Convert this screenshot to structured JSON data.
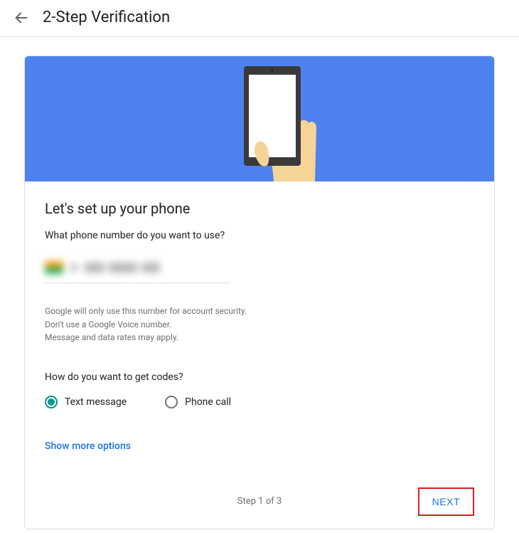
{
  "header": {
    "title": "2-Step Verification"
  },
  "main": {
    "heading": "Let's set up your phone",
    "subheading": "What phone number do you want to use?",
    "info_line_1": "Google will only use this number for account security.",
    "info_line_2": "Don't use a Google Voice number.",
    "info_line_3": "Message and data rates may apply.",
    "codes_heading": "How do you want to get codes?",
    "radio_text": "Text message",
    "radio_call": "Phone call",
    "show_more": "Show more options",
    "step_text": "Step 1 of 3",
    "next_label": "NEXT"
  }
}
